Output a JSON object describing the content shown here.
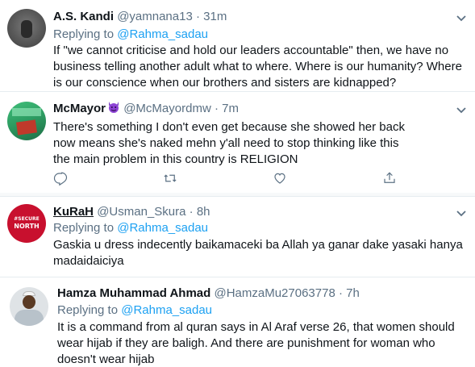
{
  "tweets": [
    {
      "name": "A.S. Kandi",
      "handle": "@yamnana13",
      "sep": "·",
      "time": "31m",
      "replying_prefix": "Replying to",
      "replying_to": "@Rahma_sadau",
      "text": "If \"we cannot criticise and hold our leaders accountable\"  then, we have no business telling another adult what to where. Where is our humanity? Where is our conscience when our brothers and sisters are kidnapped?"
    },
    {
      "name": "McMayor",
      "handle": "@McMayordmw",
      "sep": "·",
      "time": "7m",
      "name_icon": "smiling-devil-emoji-icon",
      "text": "There's something I don't even get because she showed her back now means she's naked mehn y'all need to stop thinking like this the main problem in this country is RELIGION",
      "actions": [
        "reply-icon",
        "retweet-icon",
        "like-icon",
        "share-icon"
      ]
    },
    {
      "name": "KuRaH",
      "handle": "@Usman_Skura",
      "sep": "·",
      "time": "8h",
      "avatar_text": [
        "#SECURE",
        "NORTH"
      ],
      "replying_prefix": "Replying to",
      "replying_to": "@Rahma_sadau",
      "text": "Gaskia u dress indecently baikamaceki ba Allah ya ganar dake yasaki hanya madaidaiciya"
    },
    {
      "name": "Hamza Muhammad Ahmad",
      "handle": "@HamzaMu27063778",
      "sep": "·",
      "time": "7h",
      "replying_prefix": "Replying to",
      "replying_to": "@Rahma_sadau",
      "text": "It is a command from al quran says in Al Araf verse 26, that women should wear hijab if they are baligh. And there are punishment for woman who doesn't wear hijab"
    }
  ],
  "colors": {
    "accent": "#1da1f2",
    "secondary_text": "#5b7083",
    "divider": "#e6ecf0",
    "secure_north_red": "#c8102e"
  }
}
